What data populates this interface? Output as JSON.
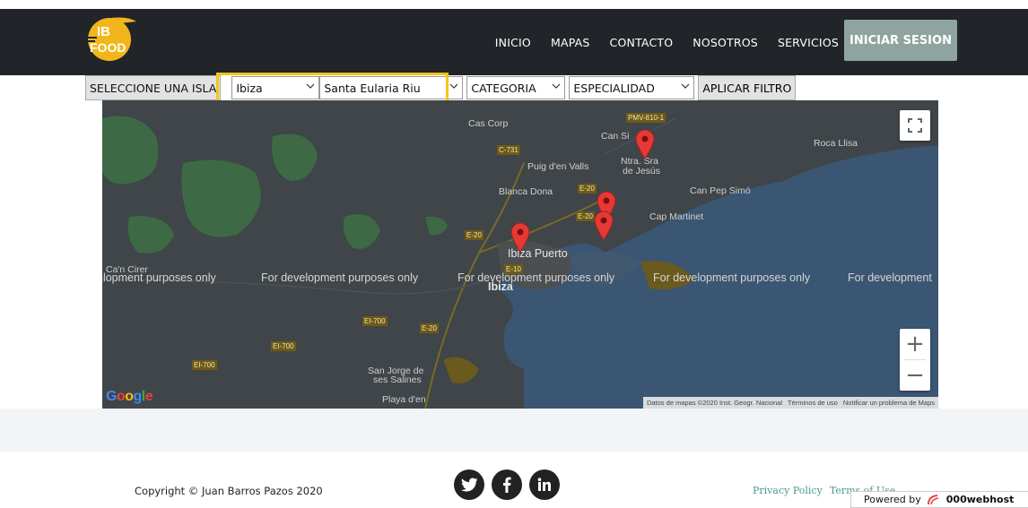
{
  "nav": {
    "logo_text": "IB FOOD",
    "links": [
      "INICIO",
      "MAPAS",
      "CONTACTO",
      "NOSOTROS",
      "SERVICIOS"
    ],
    "login_label": "INICIAR SESION"
  },
  "filters": {
    "label": "SELECCIONE UNA ISLA",
    "island": "Ibiza",
    "municipality": "Santa Eularia Riu",
    "category": "CATEGORIA",
    "specialty": "ESPECIALIDAD",
    "apply_label": "APLICAR FILTRO",
    "highlight_color": "#f5c518"
  },
  "map": {
    "dev_text": "For development purposes only",
    "dev_text_cut_left": "elopment purposes only",
    "dev_text_cut_right": "For development",
    "places": {
      "cas_corp": "Cas Corp",
      "can_sin": "Can Si",
      "ntra_sra": "Ntra. Sra",
      "de_jesus": "de Jesús",
      "roca_llisa": "Roca Llisa",
      "puig": "Puig d'en Valls",
      "blanca_dona": "Blanca Dona",
      "can_pep": "Can Pep Simó",
      "cap_martinet": "Cap Martinet",
      "ibiza_puerto": "Ibiza Puerto",
      "ibiza": "Ibiza",
      "can_cirer": "Ca'n Cirer",
      "san_jorge_1": "San Jorge de",
      "san_jorge_2": "ses Salines",
      "playa": "Playa d'en"
    },
    "roads": {
      "pmv": "PMV-810-1",
      "c731": "C-731",
      "e20a": "E-20",
      "e20b": "E-20",
      "e20c": "E-20",
      "e10": "E-10",
      "e20d": "E-20",
      "ei700a": "EI-700",
      "ei700b": "EI-700",
      "ei700c": "EI-700"
    },
    "google_logo": "Google",
    "attribution": {
      "data": "Datos de mapas ©2020 Inst. Geogr. Nacional",
      "terms": "Términos de uso",
      "report": "Notificar un problema de Maps"
    },
    "zoom_in": "+",
    "zoom_out": "−",
    "marker_color": "#e53935"
  },
  "footer": {
    "copyright": "Copyright © Juan Barros Pazos 2020",
    "socials": [
      "twitter-icon",
      "facebook-icon",
      "linkedin-icon"
    ],
    "privacy": "Privacy Policy",
    "terms": "Terms of Use",
    "powered_by": "Powered by",
    "host": "000webhost"
  }
}
